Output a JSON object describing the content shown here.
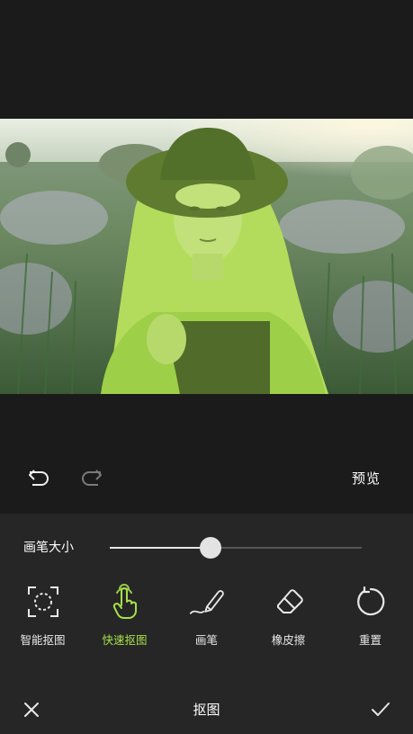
{
  "photo": {
    "description_icon": "portrait-photo-with-green-selection-overlay"
  },
  "toolbar": {
    "undo_icon": "undo-icon",
    "redo_icon": "redo-icon",
    "preview_label": "预览"
  },
  "brush": {
    "label": "画笔大小",
    "value_fraction": 0.4
  },
  "tools": [
    {
      "label": "智能抠图",
      "icon": "smart-cutout-icon",
      "active": false
    },
    {
      "label": "快速抠图",
      "icon": "quick-cutout-hand-icon",
      "active": true
    },
    {
      "label": "画笔",
      "icon": "brush-icon",
      "active": false
    },
    {
      "label": "橡皮擦",
      "icon": "eraser-icon",
      "active": false
    },
    {
      "label": "重置",
      "icon": "reset-icon",
      "active": false
    }
  ],
  "bottom_bar": {
    "title": "抠图",
    "close_icon": "close-icon",
    "confirm_icon": "check-icon"
  },
  "colors": {
    "accent": "#a6e04a",
    "background": "#1b1b1b",
    "panel": "#262626"
  }
}
